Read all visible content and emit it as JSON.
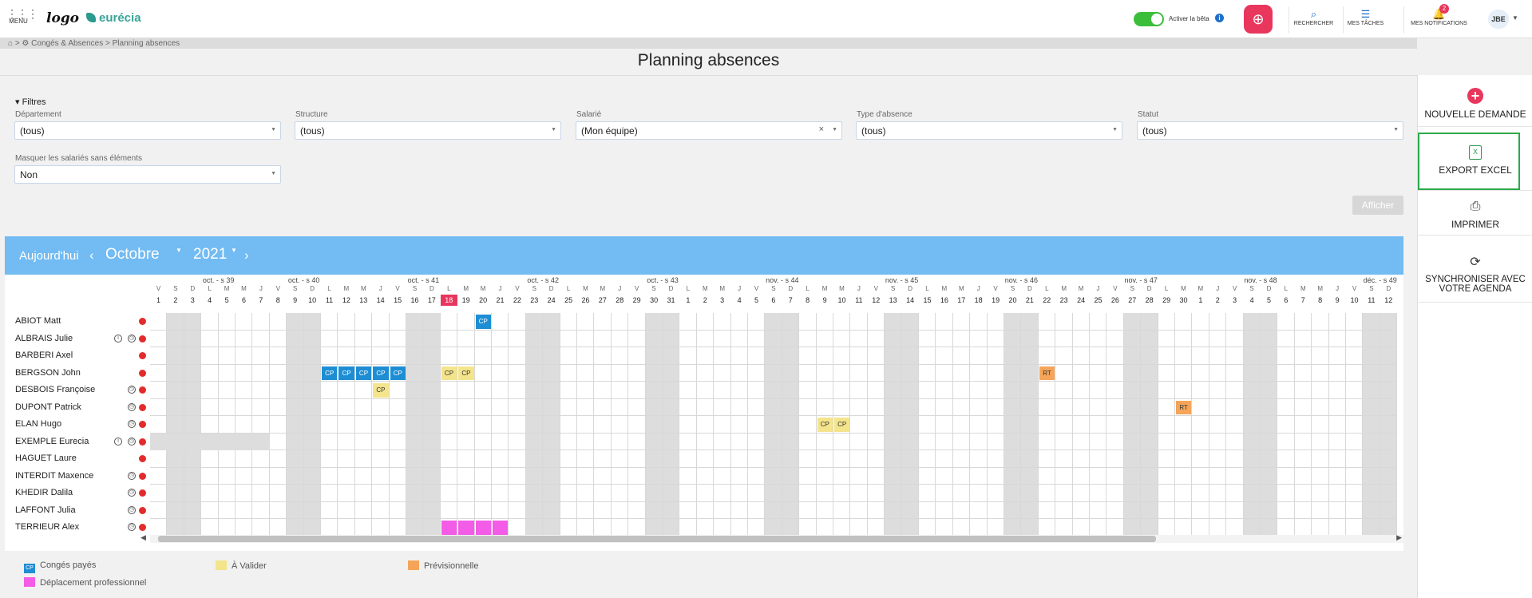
{
  "topbar": {
    "menu_label": "MENU",
    "logo_text": "logo",
    "brand": "eurécia",
    "beta_label": "Activer la bêta",
    "search_label": "RECHERCHER",
    "tasks_label": "MES TÂCHES",
    "notifications_label": "MES NOTIFICATIONS",
    "notifications_count": "2",
    "user_initials": "JBE"
  },
  "breadcrumb": "⌂  >  ⚙ Congés & Absences > Planning absences",
  "page_title": "Planning absences",
  "filters": {
    "toggle_label": "▾ Filtres",
    "departement": {
      "label": "Département",
      "value": "(tous)"
    },
    "structure": {
      "label": "Structure",
      "value": "(tous)"
    },
    "salarie": {
      "label": "Salarié",
      "value": "(Mon équipe)"
    },
    "type_absence": {
      "label": "Type d'absence",
      "value": "(tous)"
    },
    "statut": {
      "label": "Statut",
      "value": "(tous)"
    },
    "masquer": {
      "label": "Masquer les salariés sans éléments",
      "value": "Non"
    },
    "afficher": "Afficher"
  },
  "sidebar": {
    "nouvelle_demande": "NOUVELLE DEMANDE",
    "export_excel": "EXPORT EXCEL",
    "imprimer": "IMPRIMER",
    "synchroniser_1": "SYNCHRONISER AVEC",
    "synchroniser_2": "VOTRE AGENDA"
  },
  "calendar": {
    "today_label": "Aujourd'hui",
    "month": "Octobre",
    "year": "2021",
    "weeks": [
      {
        "label": "oct. - s 39",
        "col": 1
      },
      {
        "label": "oct. - s 40",
        "col": 6
      },
      {
        "label": "oct. - s 41",
        "col": 13
      },
      {
        "label": "oct. - s 42",
        "col": 20
      },
      {
        "label": "oct. - s 43",
        "col": 27
      },
      {
        "label": "nov. - s 44",
        "col": 34
      },
      {
        "label": "nov. - s 45",
        "col": 41
      },
      {
        "label": "nov. - s 46",
        "col": 48
      },
      {
        "label": "nov. - s 47",
        "col": 55
      },
      {
        "label": "nov. - s 48",
        "col": 62
      },
      {
        "label": "déc. - s 49",
        "col": 69
      }
    ],
    "days": [
      [
        "V",
        "1"
      ],
      [
        "S",
        "2"
      ],
      [
        "D",
        "3"
      ],
      [
        "L",
        "4"
      ],
      [
        "M",
        "5"
      ],
      [
        "M",
        "6"
      ],
      [
        "J",
        "7"
      ],
      [
        "V",
        "8"
      ],
      [
        "S",
        "9"
      ],
      [
        "D",
        "10"
      ],
      [
        "L",
        "11"
      ],
      [
        "M",
        "12"
      ],
      [
        "M",
        "13"
      ],
      [
        "J",
        "14"
      ],
      [
        "V",
        "15"
      ],
      [
        "S",
        "16"
      ],
      [
        "D",
        "17"
      ],
      [
        "L",
        "18"
      ],
      [
        "M",
        "19"
      ],
      [
        "M",
        "20"
      ],
      [
        "J",
        "21"
      ],
      [
        "V",
        "22"
      ],
      [
        "S",
        "23"
      ],
      [
        "D",
        "24"
      ],
      [
        "L",
        "25"
      ],
      [
        "M",
        "26"
      ],
      [
        "M",
        "27"
      ],
      [
        "J",
        "28"
      ],
      [
        "V",
        "29"
      ],
      [
        "S",
        "30"
      ],
      [
        "D",
        "31"
      ],
      [
        "L",
        "1"
      ],
      [
        "M",
        "2"
      ],
      [
        "M",
        "3"
      ],
      [
        "J",
        "4"
      ],
      [
        "V",
        "5"
      ],
      [
        "S",
        "6"
      ],
      [
        "D",
        "7"
      ],
      [
        "L",
        "8"
      ],
      [
        "M",
        "9"
      ],
      [
        "M",
        "10"
      ],
      [
        "J",
        "11"
      ],
      [
        "V",
        "12"
      ],
      [
        "S",
        "13"
      ],
      [
        "D",
        "14"
      ],
      [
        "L",
        "15"
      ],
      [
        "M",
        "16"
      ],
      [
        "M",
        "17"
      ],
      [
        "J",
        "18"
      ],
      [
        "V",
        "19"
      ],
      [
        "S",
        "20"
      ],
      [
        "D",
        "21"
      ],
      [
        "L",
        "22"
      ],
      [
        "M",
        "23"
      ],
      [
        "M",
        "24"
      ],
      [
        "J",
        "25"
      ],
      [
        "V",
        "26"
      ],
      [
        "S",
        "27"
      ],
      [
        "D",
        "28"
      ],
      [
        "L",
        "29"
      ],
      [
        "M",
        "30"
      ],
      [
        "M",
        "1"
      ],
      [
        "J",
        "2"
      ],
      [
        "V",
        "3"
      ],
      [
        "S",
        "4"
      ],
      [
        "D",
        "5"
      ],
      [
        "L",
        "6"
      ],
      [
        "M",
        "7"
      ],
      [
        "M",
        "8"
      ],
      [
        "J",
        "9"
      ],
      [
        "V",
        "10"
      ],
      [
        "S",
        "11"
      ],
      [
        "D",
        "12"
      ]
    ],
    "today_index": 17,
    "employees": [
      {
        "name": "ABIOT Matt",
        "info": false,
        "clock": false
      },
      {
        "name": "ALBRAIS Julie",
        "info": true,
        "clock": true
      },
      {
        "name": "BARBERI Axel",
        "info": false,
        "clock": false
      },
      {
        "name": "BERGSON John",
        "info": false,
        "clock": false
      },
      {
        "name": "DESBOIS Françoise",
        "info": false,
        "clock": true
      },
      {
        "name": "DUPONT Patrick",
        "info": false,
        "clock": true
      },
      {
        "name": "ELAN Hugo",
        "info": false,
        "clock": true
      },
      {
        "name": "EXEMPLE Eurecia",
        "info": true,
        "clock": true
      },
      {
        "name": "HAGUET Laure",
        "info": false,
        "clock": false
      },
      {
        "name": "INTERDIT Maxence",
        "info": false,
        "clock": true
      },
      {
        "name": "KHEDIR Dalila",
        "info": false,
        "clock": true
      },
      {
        "name": "LAFFONT Julia",
        "info": false,
        "clock": true
      },
      {
        "name": "TERRIEUR Alex",
        "info": false,
        "clock": true
      }
    ],
    "absences": [
      {
        "row": 0,
        "col": 19,
        "type": "cp",
        "label": "CP"
      },
      {
        "row": 3,
        "col": 10,
        "type": "cp",
        "label": "CP"
      },
      {
        "row": 3,
        "col": 11,
        "type": "cp",
        "label": "CP"
      },
      {
        "row": 3,
        "col": 12,
        "type": "cp",
        "label": "CP"
      },
      {
        "row": 3,
        "col": 13,
        "type": "cp",
        "label": "CP"
      },
      {
        "row": 3,
        "col": 14,
        "type": "cp",
        "label": "CP"
      },
      {
        "row": 3,
        "col": 17,
        "type": "valider",
        "label": "CP"
      },
      {
        "row": 3,
        "col": 18,
        "type": "valider",
        "label": "CP"
      },
      {
        "row": 3,
        "col": 52,
        "type": "prev",
        "label": "RT"
      },
      {
        "row": 4,
        "col": 13,
        "type": "valider",
        "label": "CP"
      },
      {
        "row": 5,
        "col": 60,
        "type": "prev",
        "label": "RT"
      },
      {
        "row": 6,
        "col": 39,
        "type": "valider",
        "label": "CP"
      },
      {
        "row": 6,
        "col": 40,
        "type": "valider",
        "label": "CP"
      },
      {
        "row": 12,
        "col": 17,
        "type": "deplacement",
        "label": ""
      },
      {
        "row": 12,
        "col": 18,
        "type": "deplacement",
        "label": ""
      },
      {
        "row": 12,
        "col": 19,
        "type": "deplacement",
        "label": ""
      },
      {
        "row": 12,
        "col": 20,
        "type": "deplacement",
        "label": ""
      }
    ],
    "unavailable": [
      {
        "row": 7,
        "from": 0,
        "to": 6
      }
    ]
  },
  "legend": {
    "conges_payes": "Congés payés",
    "cp_abbr": "CP",
    "a_valider": "À Valider",
    "previsionnelle": "Prévisionnelle",
    "deplacement": "Déplacement professionnel"
  },
  "colors": {
    "cp": "#1e8ed4",
    "valider": "#f4e48c",
    "prev": "#f5a55a",
    "deplacement": "#f25ce6",
    "weekend": "#dddddd",
    "accent": "#e8365d",
    "header": "#72bbf3"
  }
}
